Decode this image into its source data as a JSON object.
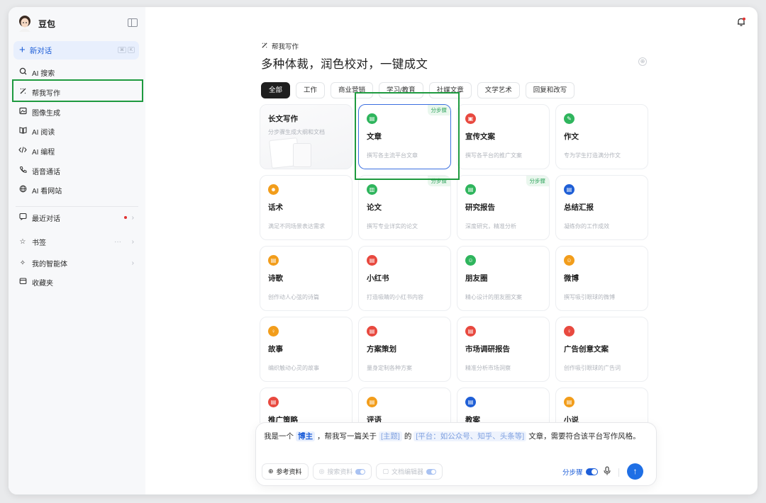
{
  "sidebar": {
    "brand": "豆包",
    "new_chat": "新对话",
    "new_chat_shortcut": [
      "⌘",
      "K"
    ],
    "items": [
      {
        "label": "AI 搜索",
        "icon": "search-icon"
      },
      {
        "label": "帮我写作",
        "icon": "pen-icon"
      },
      {
        "label": "图像生成",
        "icon": "image-icon"
      },
      {
        "label": "AI 阅读",
        "icon": "book-icon"
      },
      {
        "label": "AI 编程",
        "icon": "code-icon"
      },
      {
        "label": "语音通话",
        "icon": "phone-icon"
      },
      {
        "label": "AI 看网站",
        "icon": "globe-icon"
      }
    ],
    "recent": "最近对话",
    "bookmarks": "书签",
    "bookmarks_more": "···",
    "agents": "我的智能体",
    "favorites": "收藏夹"
  },
  "main": {
    "sub_title": "帮我写作",
    "headline": "多种体裁，润色校对，一键成文",
    "tabs": [
      "全部",
      "工作",
      "商业营销",
      "学习/教育",
      "社媒文章",
      "文学艺术",
      "回复和改写"
    ],
    "active_tab": "全部",
    "long_card": {
      "title": "长文写作",
      "desc": "分步骤生成大纲和文档"
    },
    "cards": [
      {
        "title": "文章",
        "desc": "撰写各主流平台文章",
        "color": "#2fb55d",
        "glyph": "▤",
        "badge": "分步骤"
      },
      {
        "title": "宣传文案",
        "desc": "撰写各平台的推广文案",
        "color": "#e8493f",
        "glyph": "▣",
        "badge": ""
      },
      {
        "title": "作文",
        "desc": "专为学生打造满分作文",
        "color": "#2fb55d",
        "glyph": "✎",
        "badge": ""
      },
      {
        "title": "话术",
        "desc": "满足不同场景表达需求",
        "color": "#f29d1b",
        "glyph": "☻",
        "badge": ""
      },
      {
        "title": "论文",
        "desc": "撰写专业详实的论文",
        "color": "#2fb55d",
        "glyph": "▥",
        "badge": "分步骤"
      },
      {
        "title": "研究报告",
        "desc": "深度研究，精准分析",
        "color": "#2fb55d",
        "glyph": "▤",
        "badge": "分步骤"
      },
      {
        "title": "总结汇报",
        "desc": "凝练你的工作成效",
        "color": "#1f5fd6",
        "glyph": "▤",
        "badge": ""
      },
      {
        "title": "诗歌",
        "desc": "创作动人心弦的诗篇",
        "color": "#f29d1b",
        "glyph": "▤",
        "badge": ""
      },
      {
        "title": "小红书",
        "desc": "打造吸睛的小红书内容",
        "color": "#e8493f",
        "glyph": "▤",
        "badge": ""
      },
      {
        "title": "朋友圈",
        "desc": "精心设计的朋友圈文案",
        "color": "#2fb55d",
        "glyph": "☺",
        "badge": ""
      },
      {
        "title": "微博",
        "desc": "撰写吸引眼球的微博",
        "color": "#f29d1b",
        "glyph": "☺",
        "badge": ""
      },
      {
        "title": "故事",
        "desc": "编织触动心灵的故事",
        "color": "#f29d1b",
        "glyph": "♀",
        "badge": ""
      },
      {
        "title": "方案策划",
        "desc": "量身定制各种方案",
        "color": "#e8493f",
        "glyph": "▤",
        "badge": ""
      },
      {
        "title": "市场调研报告",
        "desc": "精准分析市场洞察",
        "color": "#e8493f",
        "glyph": "▤",
        "badge": ""
      },
      {
        "title": "广告创意文案",
        "desc": "创作吸引眼球的广告词",
        "color": "#e8493f",
        "glyph": "♀",
        "badge": ""
      },
      {
        "title": "推广策略",
        "desc": "",
        "color": "#e8493f",
        "glyph": "▤",
        "badge": ""
      },
      {
        "title": "评语",
        "desc": "",
        "color": "#f29d1b",
        "glyph": "▤",
        "badge": ""
      },
      {
        "title": "教案",
        "desc": "",
        "color": "#1f5fd6",
        "glyph": "▤",
        "badge": ""
      },
      {
        "title": "小说",
        "desc": "",
        "color": "#f29d1b",
        "glyph": "▤",
        "badge": ""
      }
    ]
  },
  "composer": {
    "prompt_a": "我是一个",
    "chip_role": "博主",
    "prompt_b": "，帮我写一篇关于",
    "chip_topic": "[主题]",
    "prompt_c": "的",
    "chip_platform": "[平台：如公众号、知乎、头条等]",
    "prompt_d": "文章，需要符合该平台写作风格。",
    "tool_ref": "参考资料",
    "tool_search": "搜索资料",
    "tool_editor": "文档编辑器",
    "step_label": "分步骤"
  },
  "colors": {
    "accent": "#1d5ed8",
    "highlight_box": "#1e9a3f"
  }
}
